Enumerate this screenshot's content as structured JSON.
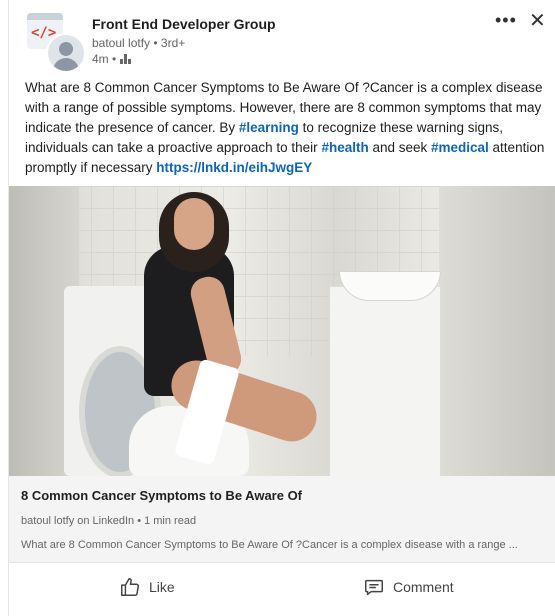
{
  "header": {
    "group_name": "Front End Developer Group",
    "author_line": "batoul lotfy • 3rd+",
    "time": "4m •",
    "logo_text": "</>",
    "more_icon": "more-icon",
    "close_icon": "close-icon"
  },
  "post": {
    "text_1": "What are 8 Common Cancer Symptoms to Be Aware Of ?Cancer is a complex disease with a range of possible symptoms. However, there are 8 common symptoms that may indicate the presence of cancer. By ",
    "tag_learning": "#learning",
    "text_2": " to recognize these warning signs, individuals can take a proactive approach to their ",
    "tag_health": "#health",
    "text_3": " and seek ",
    "tag_medical": "#medical",
    "text_4": " attention promptly if necessary ",
    "link": "https://lnkd.in/eihJwgEY",
    "link_color": "#0a66c2"
  },
  "article": {
    "title": "8 Common Cancer Symptoms to Be Aware Of",
    "meta": "batoul lotfy on LinkedIn • 1 min read",
    "description": "What are 8 Common Cancer Symptoms to Be Aware Of ?Cancer is a complex disease with a range ..."
  },
  "actions": {
    "like": "Like",
    "comment": "Comment"
  }
}
